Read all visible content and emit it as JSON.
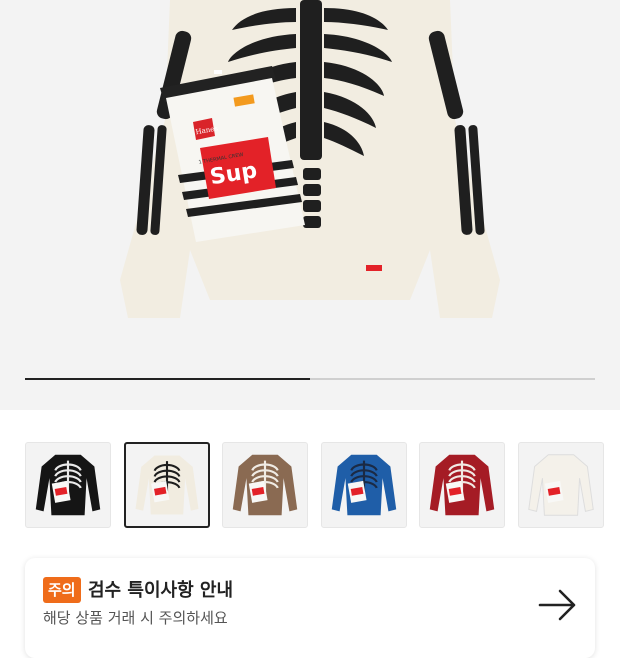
{
  "gallery": {
    "progress_fraction": 0.5,
    "product_tag": "Supreme",
    "package": {
      "brand": "Hanes",
      "logo_text": "Sup",
      "line_text": "1 THERMAL CREW"
    }
  },
  "thumbnails": [
    {
      "name": "black",
      "body": "#151515",
      "bone": "#eaeaea",
      "selected": false
    },
    {
      "name": "natural",
      "body": "#f1ece0",
      "bone": "#1d1d1d",
      "selected": true
    },
    {
      "name": "camo",
      "body": "#8a6a52",
      "bone": "#f0ebe4",
      "selected": false
    },
    {
      "name": "blue",
      "body": "#1f5ea8",
      "bone": "#1b2a44",
      "selected": false
    },
    {
      "name": "red",
      "body": "#a51c25",
      "bone": "#f1e9e4",
      "selected": false
    },
    {
      "name": "white",
      "body": "#f4f1ea",
      "bone": "#f4f1ea",
      "selected": false
    }
  ],
  "notice": {
    "badge": "주의",
    "title": "검수 특이사항 안내",
    "subtitle": "해당 상품 거래 시 주의하세요",
    "arrow_icon": "arrow-right-icon"
  },
  "colors": {
    "accent": "#ef6c1a",
    "supreme_red": "#e32228"
  }
}
